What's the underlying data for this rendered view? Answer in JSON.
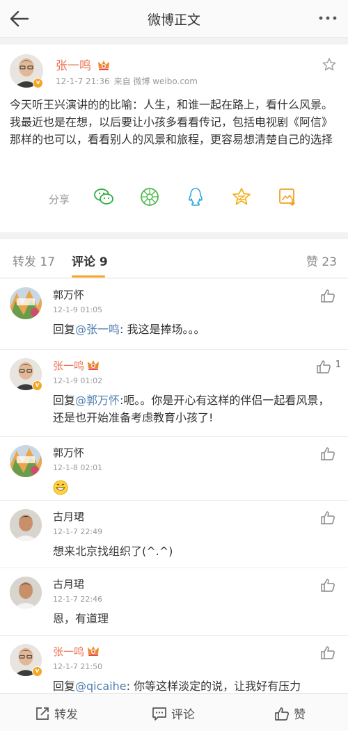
{
  "header": {
    "title": "微博正文",
    "back_icon": "back-arrow-icon",
    "more_icon": "more-dots-icon"
  },
  "post": {
    "author": "张一鸣",
    "time": "12-1-7 21:36",
    "source": "来自 微博 weibo.com",
    "text": "今天听王兴演讲的的比喻：人生，和谁一起在路上，看什么风景。 我最近也是在想，以后要让小孩多看看传记，包括电视剧《阿信》那样的也可以，看看别人的风景和旅程，更容易想清楚自己的选择",
    "share_label": "分享",
    "share_icons": [
      "wechat-icon",
      "moments-icon",
      "qq-icon",
      "qzone-star-icon",
      "save-image-icon"
    ]
  },
  "tabs": {
    "repost": "转发 17",
    "comments": "评论 9",
    "likes": "赞 23"
  },
  "comments": [
    {
      "name": "郭万怀",
      "time": "12-1-9 01:05",
      "prefix": "回复",
      "mention": "@张一鸣",
      "text": ": 我这是捧场。。。",
      "likes": ""
    },
    {
      "name": "张一鸣",
      "time": "12-1-9 01:02",
      "prefix": "回复",
      "mention": "@郭万怀",
      "text": ":呃。。你是开心有这样的伴侣一起看风景，还是也开始准备考虑教育小孩了!",
      "likes": "1"
    },
    {
      "name": "郭万怀",
      "time": "12-1-8 02:01",
      "prefix": "",
      "mention": "",
      "text": "",
      "likes": ""
    },
    {
      "name": "古月珺",
      "time": "12-1-7 22:49",
      "prefix": "",
      "mention": "",
      "text": "想来北京找组织了(^.^)",
      "likes": ""
    },
    {
      "name": "古月珺",
      "time": "12-1-7 22:46",
      "prefix": "",
      "mention": "",
      "text": "恩，有道理",
      "likes": ""
    },
    {
      "name": "张一鸣",
      "time": "12-1-7 21:50",
      "prefix": "回复",
      "mention": "@qicaihe",
      "text": ": 你等这样淡定的说，让我好有压力",
      "likes": ""
    }
  ],
  "bottom": {
    "repost": "转发",
    "comment": "评论",
    "like": "赞"
  },
  "colors": {
    "vip_name": "#eb7350",
    "mention": "#507daf",
    "accent": "#f5a623"
  }
}
